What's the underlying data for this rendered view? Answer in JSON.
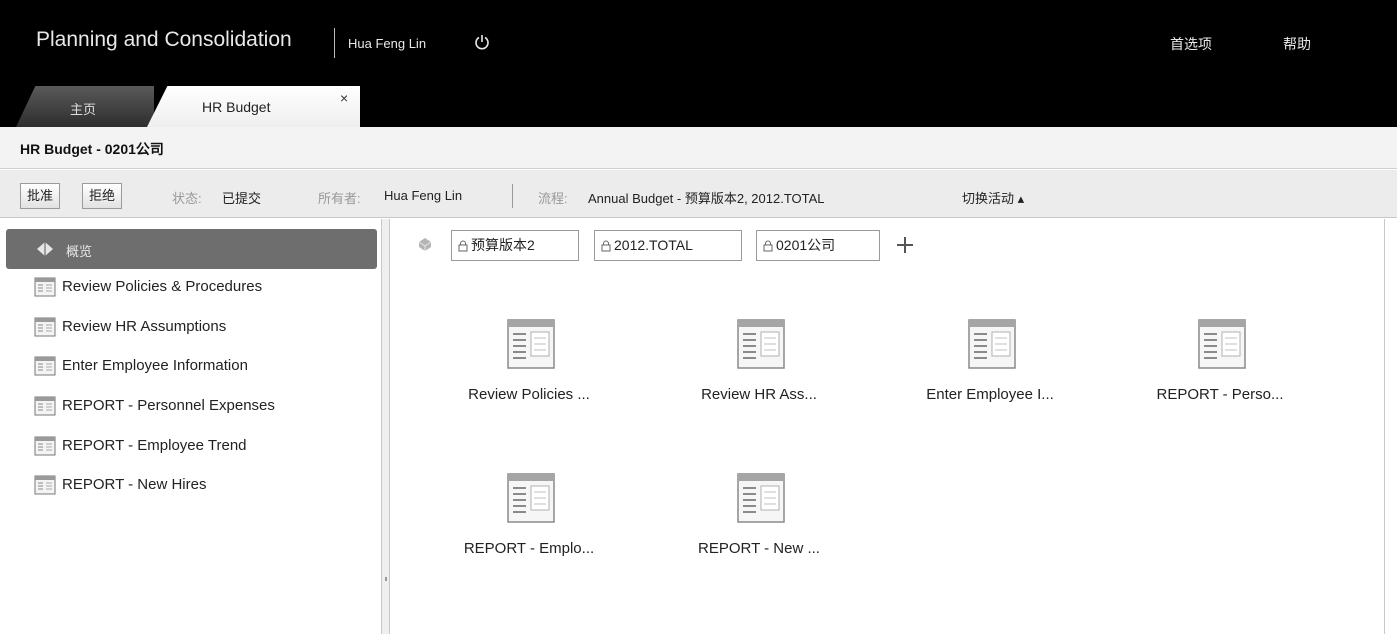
{
  "header": {
    "app_title": "Planning and Consolidation",
    "user_name": "Hua Feng Lin",
    "links": [
      "首选项",
      "帮助"
    ]
  },
  "tabs": [
    {
      "label": "主页",
      "active": false
    },
    {
      "label": "HR Budget",
      "active": true,
      "close": "×"
    }
  ],
  "page_title": "HR Budget - 0201公司",
  "toolbar": {
    "approve_label": "批准",
    "reject_label": "拒绝",
    "status_label": "状态:",
    "status_value": "已提交",
    "owner_label": "所有者:",
    "owner_value": "Hua Feng Lin",
    "process_label": "流程:",
    "process_value": "Annual Budget - 预算版本2, 2012.TOTAL",
    "switch_label": "切换活动 ▴"
  },
  "sidebar": {
    "selected_label": "概览",
    "items": [
      {
        "label": "Review Policies & Procedures"
      },
      {
        "label": "Review HR Assumptions"
      },
      {
        "label": "Enter Employee Information"
      },
      {
        "label": "REPORT - Personnel Expenses"
      },
      {
        "label": "REPORT - Employee Trend"
      },
      {
        "label": "REPORT - New Hires"
      }
    ]
  },
  "context": {
    "fields": [
      "预算版本2",
      "2012.TOTAL",
      "0201公司"
    ]
  },
  "tiles": [
    {
      "label": "Review Policies ..."
    },
    {
      "label": "Review HR Ass..."
    },
    {
      "label": "Enter Employee I..."
    },
    {
      "label": "REPORT - Perso..."
    },
    {
      "label": "REPORT - Emplo..."
    },
    {
      "label": "REPORT - New ..."
    }
  ],
  "icons": {
    "power": "power-icon",
    "overview": "overview-icon",
    "document": "document-icon",
    "context": "context-icon",
    "lock": "lock-icon",
    "add": "add-icon"
  }
}
